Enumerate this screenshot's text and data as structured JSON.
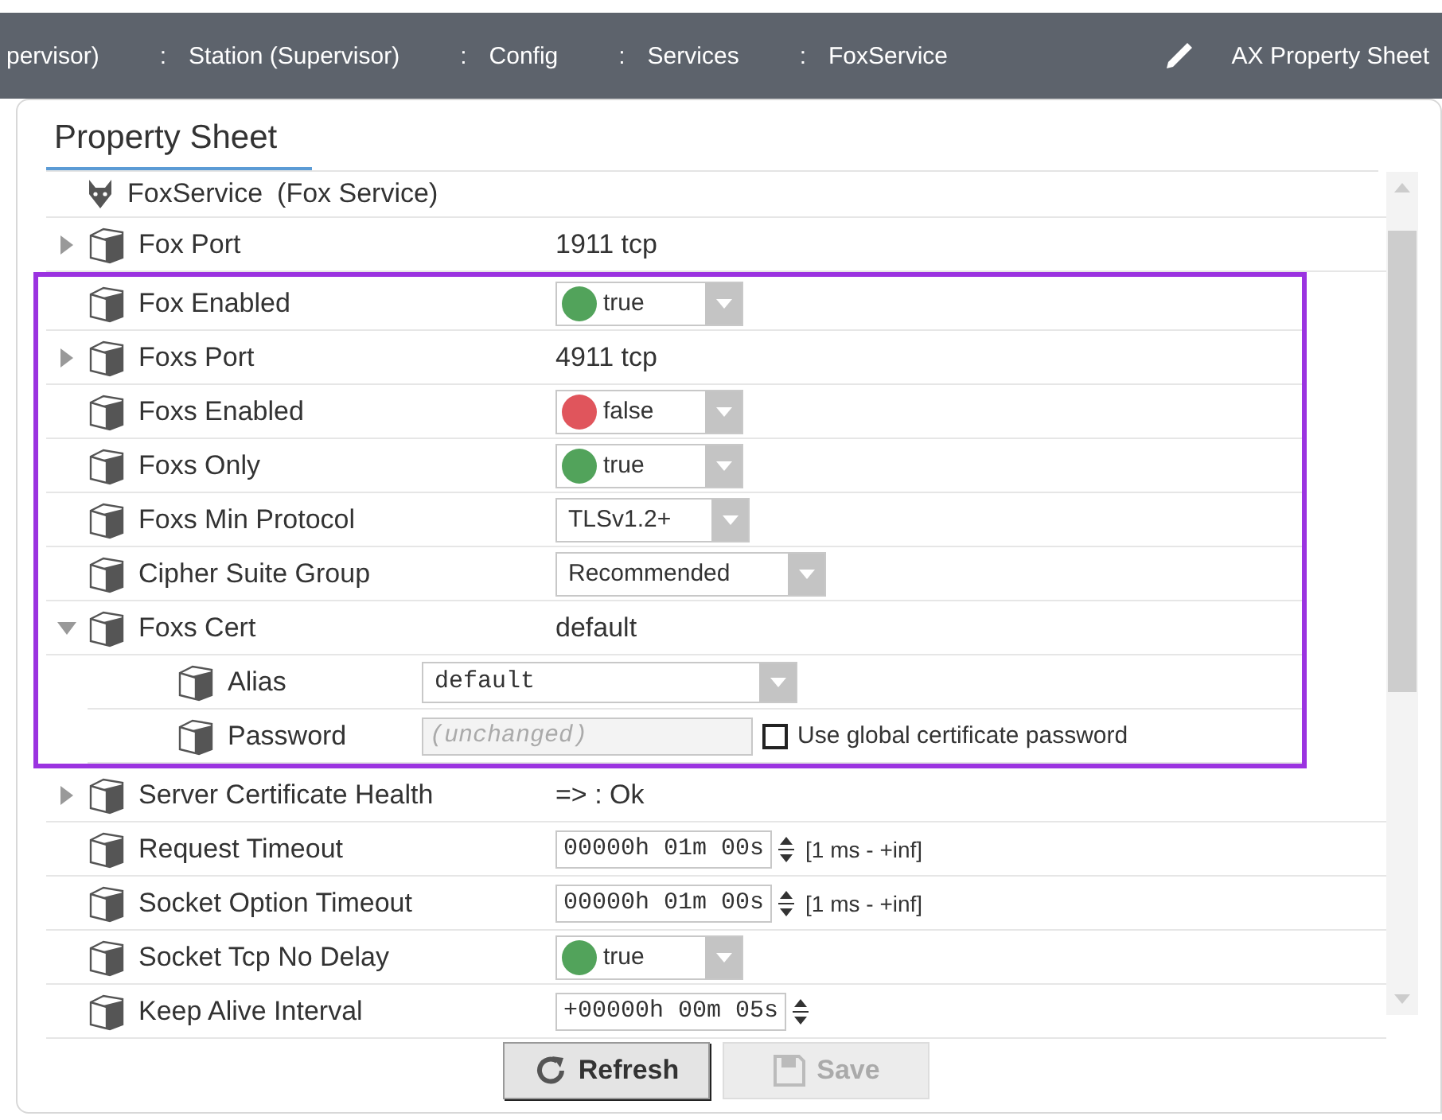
{
  "breadcrumb": [
    {
      "label": "pervisor)"
    },
    {
      "separator": ":",
      "label": "Station (Supervisor)"
    },
    {
      "separator": ":",
      "label": "Config"
    },
    {
      "separator": ":",
      "label": "Services"
    },
    {
      "separator": ":",
      "label": "FoxService"
    }
  ],
  "view_selector": {
    "label": "AX Property Sheet"
  },
  "tabs": [
    {
      "label": "Property Sheet",
      "selected": true
    }
  ],
  "root": {
    "name": "FoxService",
    "type_label": "(Fox Service)"
  },
  "sections": [
    {
      "kind": "plain",
      "rows": [
        {
          "name": "Fox Port",
          "expanded": false,
          "kind": "text",
          "value": "1911 tcp"
        }
      ]
    },
    {
      "kind": "highlighted",
      "rows": [
        {
          "name": "Fox Enabled",
          "kind": "boolean",
          "value": "true",
          "color": "#52a35b"
        },
        {
          "name": "Foxs Port",
          "expanded": false,
          "kind": "text",
          "value": "4911 tcp"
        },
        {
          "name": "Foxs Enabled",
          "kind": "boolean",
          "value": "false",
          "color": "#e0555c"
        },
        {
          "name": "Foxs Only",
          "kind": "boolean",
          "value": "true",
          "color": "#52a35b"
        },
        {
          "name": "Foxs Min Protocol",
          "kind": "select",
          "value": "TLSv1.2+"
        },
        {
          "name": "Cipher Suite Group",
          "kind": "select",
          "value": "Recommended"
        },
        {
          "name": "Foxs Cert",
          "expanded": true,
          "kind": "text",
          "value": "default",
          "children": [
            {
              "name": "Alias",
              "kind": "alias",
              "value": "default"
            },
            {
              "name": "Password",
              "kind": "password",
              "placeholder": "(unchanged)",
              "checkbox": {
                "label": "Use global certificate password",
                "checked": false
              }
            }
          ]
        }
      ]
    },
    {
      "kind": "plain",
      "rows": [
        {
          "name": "Server Certificate Health",
          "expanded": false,
          "kind": "text",
          "value": "=> : Ok"
        },
        {
          "name": "Request Timeout",
          "kind": "reltime",
          "value": "00000h 01m 00s",
          "range": "[1 ms - +inf]"
        },
        {
          "name": "Socket Option Timeout",
          "kind": "reltime",
          "value": "00000h 01m 00s",
          "range": "[1 ms - +inf]"
        },
        {
          "name": "Socket Tcp No Delay",
          "kind": "boolean",
          "value": "true",
          "color": "#52a35b"
        },
        {
          "name": "Keep Alive Interval",
          "kind": "reltime",
          "value": "+00000h 00m 05s"
        }
      ]
    }
  ],
  "buttons": [
    {
      "label": "Refresh",
      "kind": "refresh",
      "disabled": false
    },
    {
      "label": "Save",
      "kind": "save",
      "disabled": true
    }
  ]
}
